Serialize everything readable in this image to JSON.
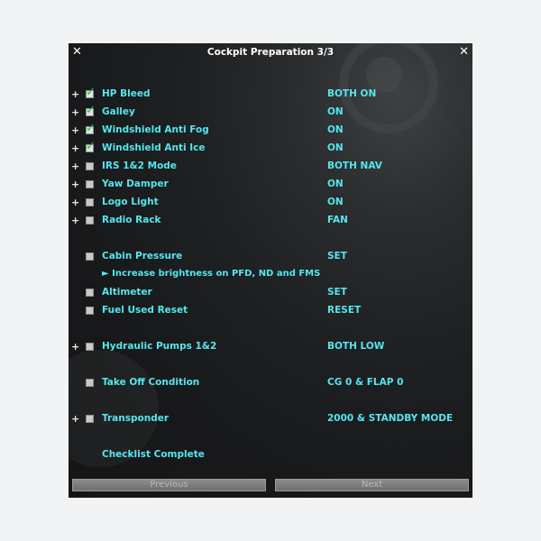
{
  "window": {
    "title": "Cockpit Preparation 3/3",
    "close_glyph": "✕"
  },
  "items": [
    {
      "label": "HP Bleed",
      "value": "BOTH ON",
      "checked": true,
      "expand": true
    },
    {
      "label": "Galley",
      "value": "ON",
      "checked": true,
      "expand": true
    },
    {
      "label": "Windshield Anti Fog",
      "value": "ON",
      "checked": true,
      "expand": true
    },
    {
      "label": "Windshield Anti Ice",
      "value": "ON",
      "checked": true,
      "expand": true
    },
    {
      "label": "IRS 1&2 Mode",
      "value": "BOTH NAV",
      "checked": false,
      "expand": true
    },
    {
      "label": "Yaw Damper",
      "value": "ON",
      "checked": false,
      "expand": true
    },
    {
      "label": "Logo Light",
      "value": "ON",
      "checked": false,
      "expand": true
    },
    {
      "label": "Radio Rack",
      "value": "FAN",
      "checked": false,
      "expand": true
    },
    {
      "label": "Cabin Pressure",
      "value": "SET",
      "checked": false,
      "expand": false
    },
    {
      "label": "Altimeter",
      "value": "SET",
      "checked": false,
      "expand": false
    },
    {
      "label": "Fuel Used Reset",
      "value": "RESET",
      "checked": false,
      "expand": false
    },
    {
      "label": "Hydraulic Pumps 1&2",
      "value": "BOTH LOW",
      "checked": false,
      "expand": true
    },
    {
      "label": "Take Off Condition",
      "value": "CG 0 & FLAP 0",
      "checked": false,
      "expand": false
    },
    {
      "label": "Transponder",
      "value": "2000 & STANDBY MODE",
      "checked": false,
      "expand": true
    }
  ],
  "note": "► Increase brightness on PFD, ND and FMS",
  "status": "Checklist Complete",
  "buttons": {
    "previous": "Previous",
    "next": "Next"
  },
  "glyphs": {
    "plus": "+",
    "check": "✓"
  },
  "colors": {
    "text_cyan": "#55e6ee",
    "check_green": "#22c43a"
  }
}
